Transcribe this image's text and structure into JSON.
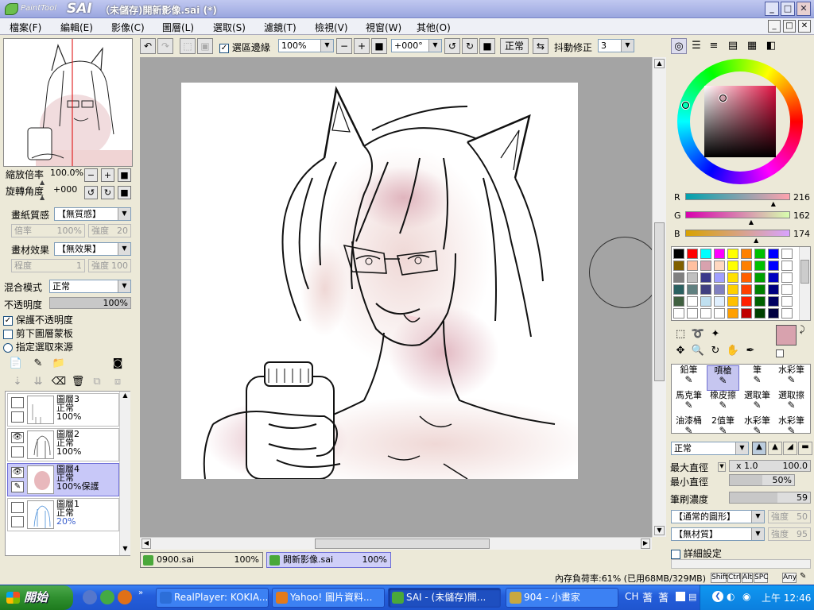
{
  "window": {
    "app_name_small": "PaintTool",
    "app_name_big": "SAI",
    "title": "（未儲存)開新影像.sai (*)",
    "controls": [
      "_",
      "□",
      "✕"
    ]
  },
  "menubar": {
    "items": [
      "檔案(F)",
      "編輯(E)",
      "影像(C)",
      "圖層(L)",
      "選取(S)",
      "濾鏡(T)",
      "檢視(V)",
      "視窗(W)",
      "其他(O)"
    ],
    "mdi_controls": [
      "_",
      "□",
      "✕"
    ]
  },
  "navigator": {
    "zoom_label": "縮放倍率",
    "zoom_value": "100.0%",
    "rotate_label": "旋轉角度",
    "rotate_value": "+000"
  },
  "paper": {
    "texture_label": "畫紙質感",
    "texture_value": "【無質感】",
    "texture_scale_label": "倍率",
    "texture_scale_value": "100%",
    "texture_strength_label": "強度",
    "texture_strength_value": "20",
    "effect_label": "畫材效果",
    "effect_value": "【無效果】",
    "effect_degree_label": "程度",
    "effect_degree_value": "1",
    "effect_strength_label": "強度",
    "effect_strength_value": "100"
  },
  "layer_props": {
    "blend_label": "混合模式",
    "blend_value": "正常",
    "opacity_label": "不透明度",
    "opacity_value": "100%",
    "opacity_fraction": 1.0,
    "protect_alpha": "保護不透明度",
    "clip_group": "剪下圖層蒙板",
    "selection_source": "指定選取來源"
  },
  "layers": [
    {
      "name": "圖層3",
      "mode": "正常",
      "opacity": "100%",
      "visible": false,
      "selected": false
    },
    {
      "name": "圖層2",
      "mode": "正常",
      "opacity": "100%",
      "visible": true,
      "selected": false
    },
    {
      "name": "圖層4",
      "mode": "正常",
      "opacity": "100%保護",
      "visible": true,
      "selected": true
    },
    {
      "name": "圖層1",
      "mode": "正常",
      "opacity": "20%",
      "visible": false,
      "selected": false
    }
  ],
  "toolbar": {
    "selection_edge_label": "選區邊緣",
    "zoom_value": "100%",
    "angle_value": "+000°",
    "blend_mode": "正常",
    "stabilizer_label": "抖動修正",
    "stabilizer_value": "3"
  },
  "color": {
    "r_label": "R",
    "r_value": "216",
    "r": 216,
    "g_label": "G",
    "g_value": "162",
    "g": 162,
    "b_label": "B",
    "b_value": "174",
    "b": 174,
    "current_color": "#d8a2ae"
  },
  "palette_colors": [
    "#000000",
    "#ff0000",
    "#00ffff",
    "#ff00ff",
    "#ffff00",
    "#ff8000",
    "#00c000",
    "#0000ff",
    "#ffffff",
    "#806000",
    "#ffc0a0",
    "#d8a2ae",
    "#ffd8c0",
    "#ffff00",
    "#ff8000",
    "#00c000",
    "#0000ff",
    "#ffffff",
    "#808080",
    "#c0c0c0",
    "#3a3a8a",
    "#a0a0ff",
    "#ffe000",
    "#ff6000",
    "#00a000",
    "#0000c0",
    "#ffffff",
    "#2a6060",
    "#608080",
    "#404080",
    "#8080c0",
    "#ffd000",
    "#ff4000",
    "#008000",
    "#000080",
    "#ffffff",
    "#406040",
    "#ffffff",
    "#c0e0f0",
    "#e0f0ff",
    "#ffc000",
    "#ff2000",
    "#006000",
    "#000060",
    "#ffffff",
    "#ffffff",
    "#ffffff",
    "#ffffff",
    "#ffffff",
    "#ffa000",
    "#c00000",
    "#004000",
    "#000040",
    "#ffffff"
  ],
  "tools": [
    {
      "label": "鉛筆",
      "selected": false
    },
    {
      "label": "噴槍",
      "selected": true
    },
    {
      "label": "筆",
      "selected": false
    },
    {
      "label": "水彩筆",
      "selected": false
    },
    {
      "label": "馬克筆",
      "selected": false
    },
    {
      "label": "橡皮擦",
      "selected": false
    },
    {
      "label": "選取筆",
      "selected": false
    },
    {
      "label": "選取擦",
      "selected": false
    },
    {
      "label": "油漆桶",
      "selected": false
    },
    {
      "label": "2值筆",
      "selected": false
    },
    {
      "label": "水彩筆",
      "selected": false
    },
    {
      "label": "水彩筆",
      "selected": false
    }
  ],
  "brush": {
    "mode": "正常",
    "max_size_label": "最大直徑",
    "max_size_mult": "x 1.0",
    "max_size_value": "100.0",
    "min_size_label": "最小直徑",
    "min_size_value": "50%",
    "min_size_fraction": 0.5,
    "density_label": "筆刷濃度",
    "density_value": "59",
    "density_fraction": 0.59,
    "shape": "【通常的圓形】",
    "shape_strength_label": "強度",
    "shape_strength_value": "50",
    "texture": "【無材質】",
    "texture_strength_label": "強度",
    "texture_strength_value": "95",
    "advanced_label": "詳細設定"
  },
  "documents": [
    {
      "name": "0900.sai",
      "zoom": "100%",
      "active": false
    },
    {
      "name": "開新影像.sai",
      "zoom": "100%",
      "active": true
    }
  ],
  "status": {
    "memory": "內存負荷率:61% (已用68MB/329MB)",
    "keys": [
      "Shift",
      "Ctrl",
      "Alt",
      "SPC",
      "Any"
    ]
  },
  "taskbar": {
    "start_label": "開始",
    "tasks": [
      {
        "label": "RealPlayer: KOKIA...",
        "color": "#2c6ed8",
        "active": false
      },
      {
        "label": "Yahoo! 圖片資料...",
        "color": "#e27a1b",
        "active": false
      },
      {
        "label": "SAI - (未儲存)開...",
        "color": "#4aa83a",
        "active": true
      },
      {
        "label": "904 - 小畫家",
        "color": "#c8a840",
        "active": false
      }
    ],
    "tray_lang": "CH",
    "clock": "上午 12:46"
  }
}
